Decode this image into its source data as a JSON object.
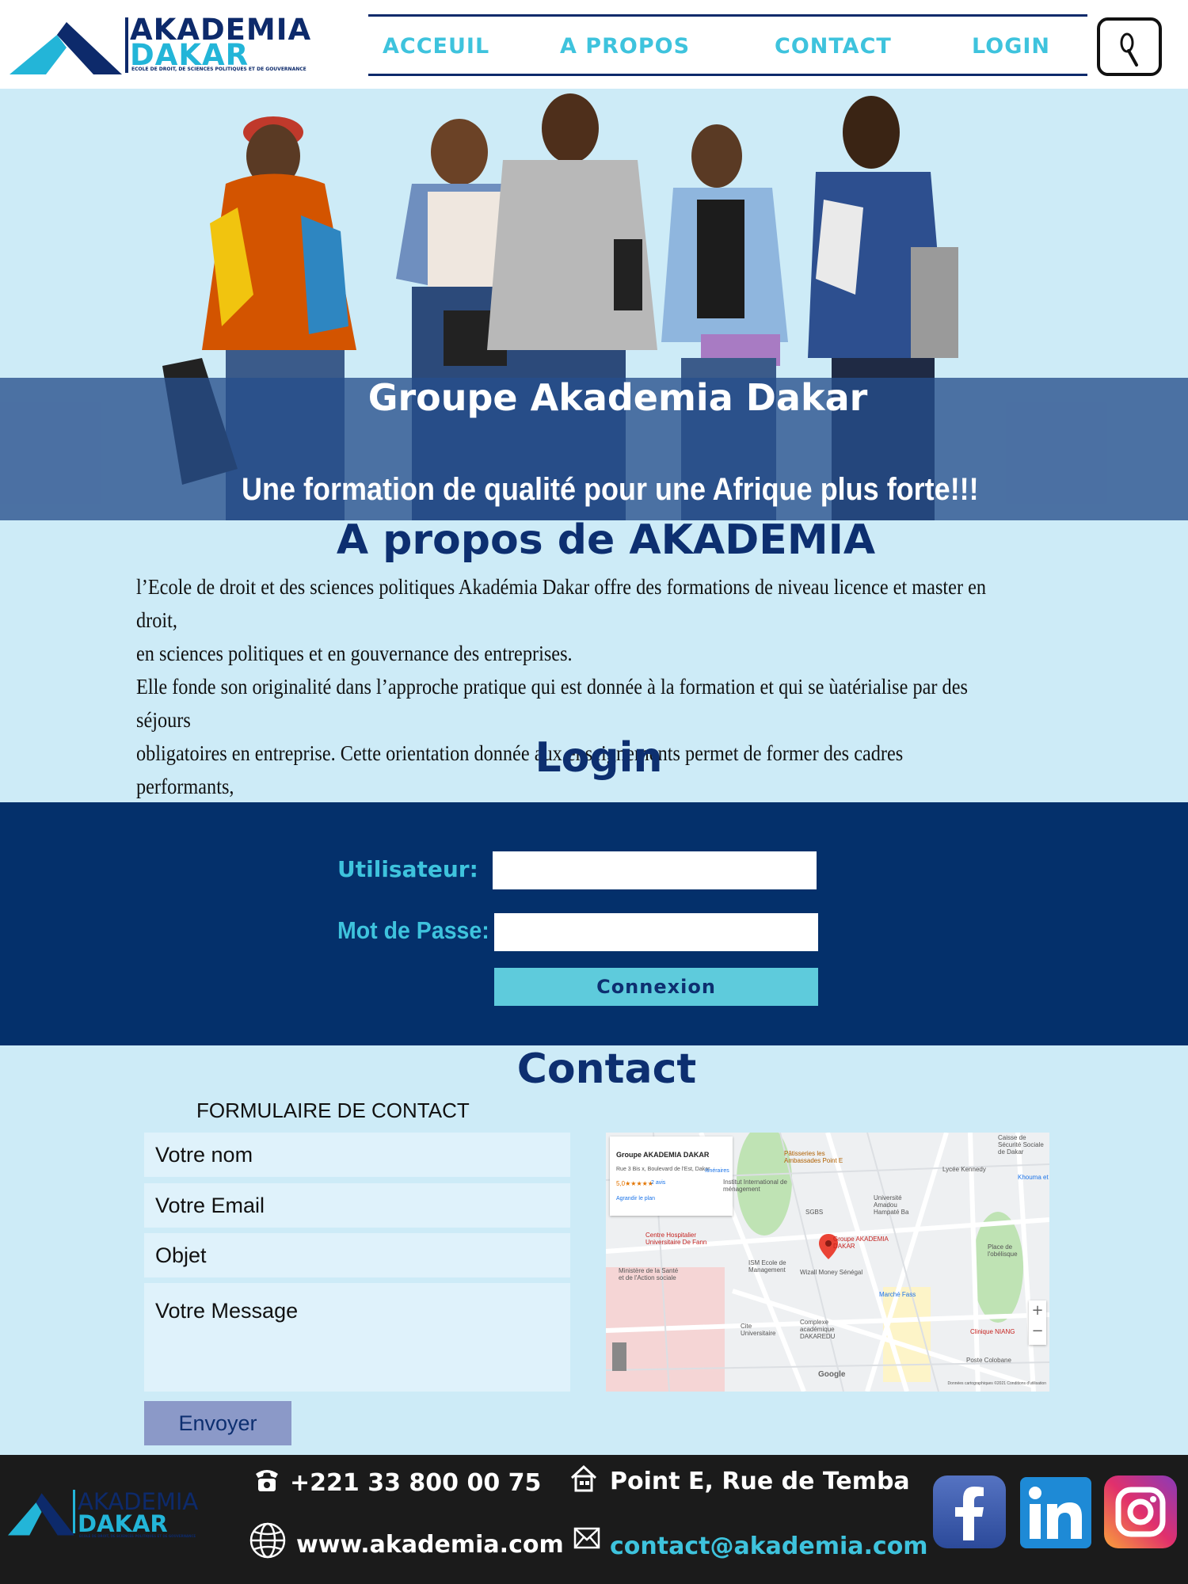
{
  "brand": {
    "name_line1": "AKADEMIA",
    "name_line2": "DAKAR",
    "subtitle": "ECOLE DE DROIT, DE SCIENCES POLITIQUES ET DE GOUVERNANCE"
  },
  "nav": {
    "items": [
      "ACCEUIL",
      "A PROPOS",
      "CONTACT",
      "LOGIN"
    ],
    "search_icon": "search-icon"
  },
  "hero": {
    "title": "Groupe Akademia Dakar",
    "tagline": "Une formation de qualité pour une Afrique plus forte!!!"
  },
  "about": {
    "title": "A propos de AKADEMIA",
    "text": "l’Ecole de droit et des sciences politiques Akadémia Dakar offre des formations de niveau licence et master en droit,\n en sciences politiques et en gouvernance des entreprises.\nElle fonde son originalité dans l’approche pratique qui est donnée à la formation et qui se ùatérialise par des séjours\nobligatoires en entreprise. Cette orientation donnée aux enseignements permet de former des cadres performants,\naptes à apporter des solutions aux problèmes du secteur privé et public."
  },
  "login": {
    "title": "Login",
    "user_label": "Utilisateur:",
    "password_label": "Mot de Passe:",
    "submit_label": "Connexion"
  },
  "contact": {
    "title": "Contact",
    "form_label": "FORMULAIRE DE CONTACT",
    "name_placeholder": "Votre nom",
    "email_placeholder": "Votre Email",
    "subject_placeholder": "Objet",
    "message_placeholder": "Votre Message",
    "submit_label": "Envoyer"
  },
  "map": {
    "card_title": "Groupe AKADEMIA DAKAR",
    "card_address": "Rue 3 Bis x, Boulevard de l'Est, Dakar",
    "card_rating": "5,0★★★★★",
    "card_reviews": "2 avis",
    "card_enlarge": "Agrandir le plan",
    "card_directions": "Itinéraires",
    "pin_label": "Groupe AKADEMIA DAKAR",
    "places": [
      "Pâtisseries les Ambassades Point E",
      "Institut International de ménagement",
      "SGBS",
      "Université Amadou Hampaté Ba",
      "Lycée Kennedy",
      "Caisse de Sécurité Sociale de Dakar",
      "Centre Hospitalier Universitaire De Fann",
      "Ministère de la Santé et de l'Action sociale",
      "ISM Ecole de Management",
      "Wizall Money Sénégal",
      "Marché Fass",
      "Place de l'obélisque",
      "Complexe académique DAKAREDU",
      "Cite Universitaire",
      "Clinique NIANG",
      "Poste Colobane",
      "Khouma et"
    ],
    "google": "Google",
    "credit": "Données cartographiques ©2021   Conditions d'utilisation"
  },
  "footer": {
    "phone": "+221 33 800 00 75",
    "address": "Point E, Rue de Temba",
    "website": "www.akademia.com",
    "email": "contact@akademia.com",
    "icons": [
      "phone-icon",
      "home-icon",
      "globe-icon",
      "mail-icon",
      "facebook-icon",
      "linkedin-icon",
      "instagram-icon"
    ]
  },
  "colors": {
    "navy": "#0d2f70",
    "cyan": "#3ec3dd",
    "page_bg": "#cdebf7",
    "login_bg": "#04306b",
    "footer_bg": "#1b1b1b"
  }
}
